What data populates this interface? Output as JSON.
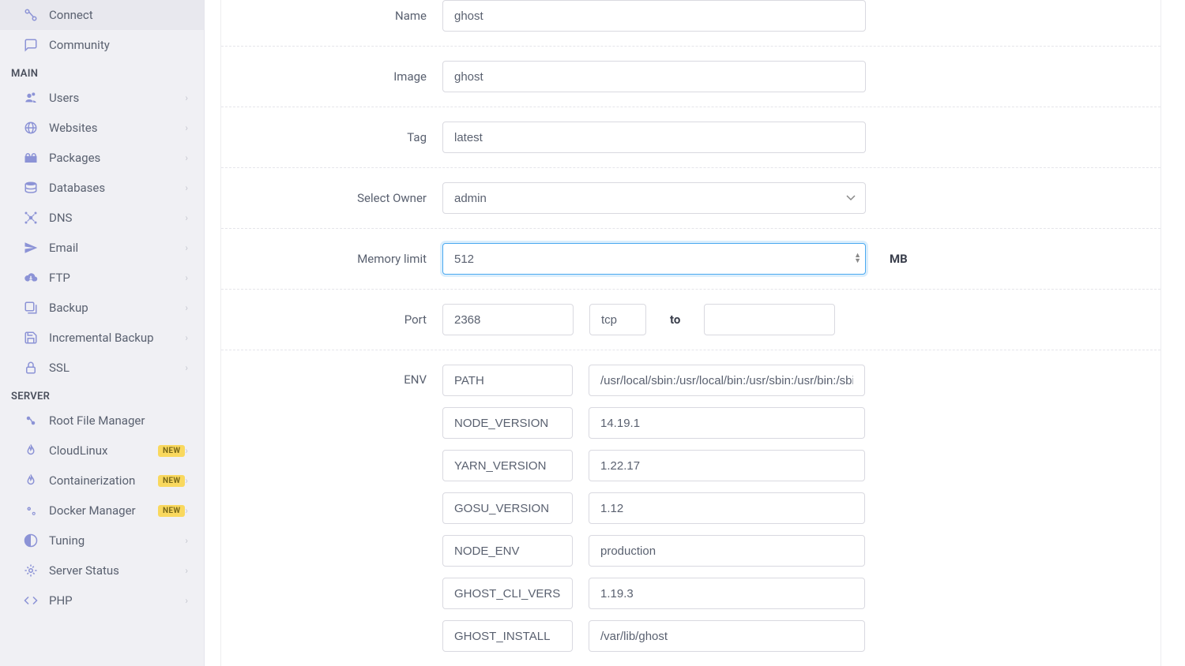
{
  "sidebar": {
    "top_items": [
      {
        "label": "Connect"
      },
      {
        "label": "Community"
      }
    ],
    "section_main_header": "MAIN",
    "main_items": [
      {
        "label": "Users",
        "chevron": true
      },
      {
        "label": "Websites",
        "chevron": true
      },
      {
        "label": "Packages",
        "chevron": true
      },
      {
        "label": "Databases",
        "chevron": true
      },
      {
        "label": "DNS",
        "chevron": true
      },
      {
        "label": "Email",
        "chevron": true
      },
      {
        "label": "FTP",
        "chevron": true
      },
      {
        "label": "Backup",
        "chevron": true
      },
      {
        "label": "Incremental Backup",
        "chevron": true
      },
      {
        "label": "SSL",
        "chevron": true
      }
    ],
    "section_server_header": "SERVER",
    "server_items": [
      {
        "label": "Root File Manager"
      },
      {
        "label": "CloudLinux",
        "new": true,
        "chevron": true
      },
      {
        "label": "Containerization",
        "new": true,
        "chevron": true
      },
      {
        "label": "Docker Manager",
        "new": true,
        "chevron": true
      },
      {
        "label": "Tuning",
        "chevron": true
      },
      {
        "label": "Server Status",
        "chevron": true
      },
      {
        "label": "PHP",
        "chevron": true
      }
    ],
    "new_badge": "NEW"
  },
  "form": {
    "name_label": "Name",
    "name_value": "ghost",
    "image_label": "Image",
    "image_value": "ghost",
    "tag_label": "Tag",
    "tag_value": "latest",
    "owner_label": "Select Owner",
    "owner_value": "admin",
    "memory_label": "Memory limit",
    "memory_value": "512",
    "memory_unit": "MB",
    "port_label": "Port",
    "port_value": "2368",
    "port_proto": "tcp",
    "port_to": "to",
    "port_to_value": "",
    "env_label": "ENV",
    "env_rows": [
      {
        "key": "PATH",
        "val": "/usr/local/sbin:/usr/local/bin:/usr/sbin:/usr/bin:/sbin:"
      },
      {
        "key": "NODE_VERSION",
        "val": "14.19.1"
      },
      {
        "key": "YARN_VERSION",
        "val": "1.22.17"
      },
      {
        "key": "GOSU_VERSION",
        "val": "1.12"
      },
      {
        "key": "NODE_ENV",
        "val": "production"
      },
      {
        "key": "GHOST_CLI_VERSION",
        "val": "1.19.3"
      },
      {
        "key": "GHOST_INSTALL",
        "val": "/var/lib/ghost"
      }
    ]
  }
}
